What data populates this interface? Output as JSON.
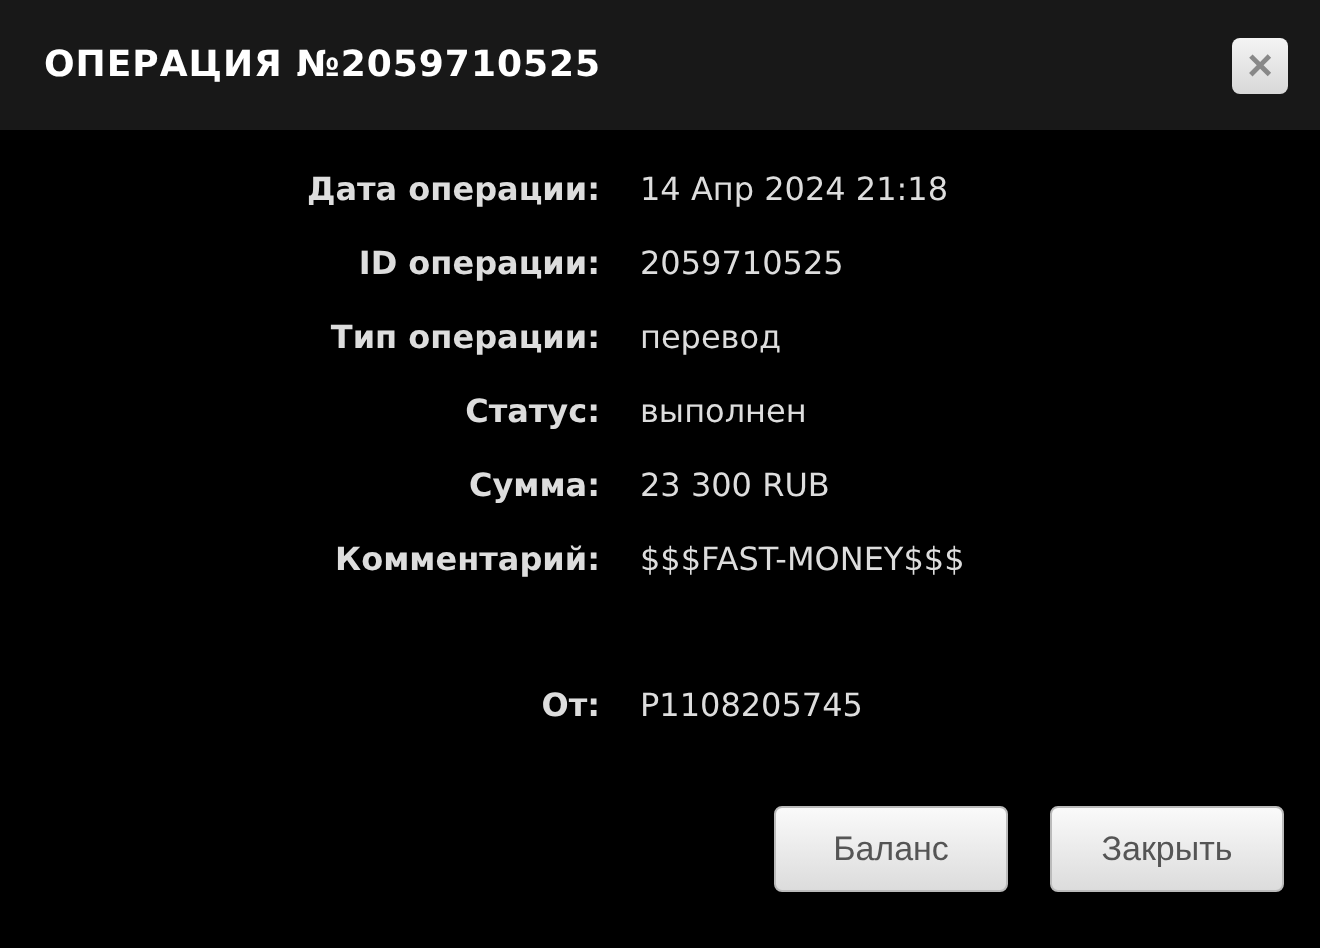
{
  "window": {
    "title": "ОПЕРАЦИЯ №2059710525",
    "close": "×"
  },
  "details": [
    {
      "label": "Дата операции:",
      "value": "14 Апр 2024 21:18"
    },
    {
      "label": "ID операции:",
      "value": "2059710525"
    },
    {
      "label": "Тип операции:",
      "value": "перевод"
    },
    {
      "label": "Статус:",
      "value": "выполнен"
    },
    {
      "label": "Сумма:",
      "value": "23 300 RUB"
    },
    {
      "label": "Комментарий:",
      "value": "$$$FAST-MONEY$$$"
    }
  ],
  "sender": [
    {
      "label": "От:",
      "value": "P1108205745"
    }
  ],
  "buttons": [
    "Баланс",
    "Закрыть"
  ]
}
